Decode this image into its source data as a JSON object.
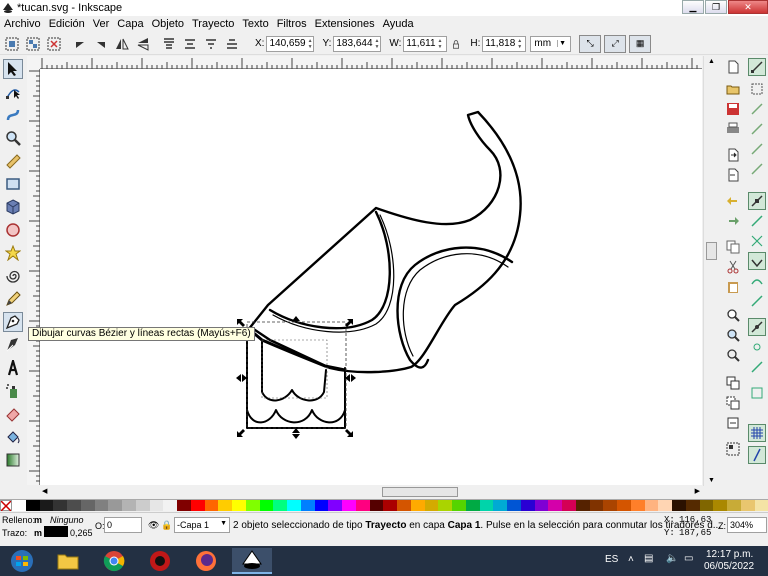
{
  "window": {
    "title": "*tucan.svg - Inkscape"
  },
  "menu": [
    "Archivo",
    "Edición",
    "Ver",
    "Capa",
    "Objeto",
    "Trayecto",
    "Texto",
    "Filtros",
    "Extensiones",
    "Ayuda"
  ],
  "toolcontrols": {
    "x_label": "X:",
    "x_value": "140,659",
    "y_label": "Y:",
    "y_value": "183,644",
    "w_label": "W:",
    "w_value": "11,611",
    "h_label": "H:",
    "h_value": "11,818",
    "unit": "mm"
  },
  "tooltip": "Dibujar curvas Bézier y líneas rectas (Mayús+F6)",
  "status": {
    "fill_label": "Relleno:",
    "fill_short": "m",
    "fill_value": "Ninguno",
    "stroke_label": "Trazo:",
    "stroke_short": "m",
    "stroke_width": "0,265",
    "opacity_label": "O:",
    "opacity_value": "0",
    "layer": "-Capa 1",
    "message_pre": "2 objeto seleccionado de tipo ",
    "message_type": "Trayecto",
    "message_mid": " en capa ",
    "message_layer": "Capa 1",
    "message_post": ". Pulse en la selección para conmutar los tiradores d...",
    "coord_x_label": "X:",
    "coord_x": "116,63",
    "coord_y_label": "Y:",
    "coord_y": "187,65",
    "zoom_label": "Z:",
    "zoom_value": "304%"
  },
  "taskbar": {
    "lang": "ES",
    "time": "12:17 p.m.",
    "date": "06/05/2022"
  },
  "palette_colors": [
    "#ffffff",
    "#000000",
    "#1a1a1a",
    "#333333",
    "#4d4d4d",
    "#666666",
    "#808080",
    "#999999",
    "#b3b3b3",
    "#cccccc",
    "#e6e6e6",
    "#f2f2f2",
    "#800000",
    "#ff0000",
    "#ff6600",
    "#ffcc00",
    "#ffff00",
    "#80ff00",
    "#00ff00",
    "#00ff80",
    "#00ffff",
    "#0080ff",
    "#0000ff",
    "#8000ff",
    "#ff00ff",
    "#ff0080",
    "#550000",
    "#aa0000",
    "#d45500",
    "#ffaa00",
    "#d4aa00",
    "#aad400",
    "#55d400",
    "#00aa44",
    "#00d4aa",
    "#00aad4",
    "#0055d4",
    "#2a00d4",
    "#7f00d4",
    "#d400aa",
    "#d40055",
    "#552200",
    "#803300",
    "#aa4400",
    "#d45500",
    "#ff7f2a",
    "#ffb380",
    "#ffd5b3",
    "#2b1100",
    "#552a00",
    "#806600",
    "#aa8800",
    "#c8ab37",
    "#e9c66f",
    "#f4e3a5"
  ]
}
